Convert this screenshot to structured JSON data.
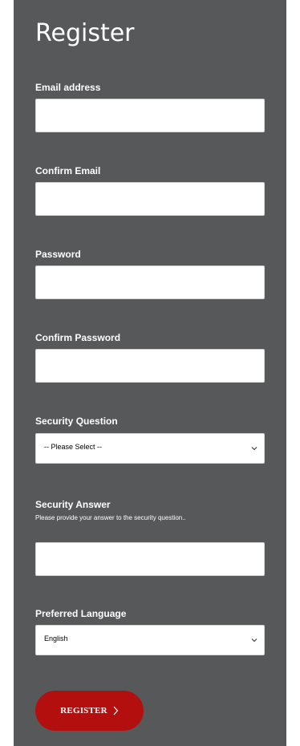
{
  "form": {
    "title": "Register",
    "fields": [
      {
        "label": "Email address",
        "value": ""
      },
      {
        "label": "Confirm Email",
        "value": ""
      },
      {
        "label": "Password",
        "value": ""
      },
      {
        "label": "Confirm Password",
        "value": ""
      }
    ],
    "security_question": {
      "label": "Security Question",
      "selected": "-- Please Select --"
    },
    "security_answer": {
      "label": "Security Answer",
      "hint": "Please provide your answer to the security question..",
      "value": ""
    },
    "preferred_language": {
      "label": "Preferred Language",
      "selected": "English"
    },
    "register_button": {
      "label": "REGISTER"
    }
  },
  "icons": {
    "select_chevron": "chevron-down-icon",
    "button_arrow": "chevron-right-icon"
  },
  "colors": {
    "panel": "#56585a",
    "button": "#b30f0f",
    "text": "#ffffff"
  }
}
